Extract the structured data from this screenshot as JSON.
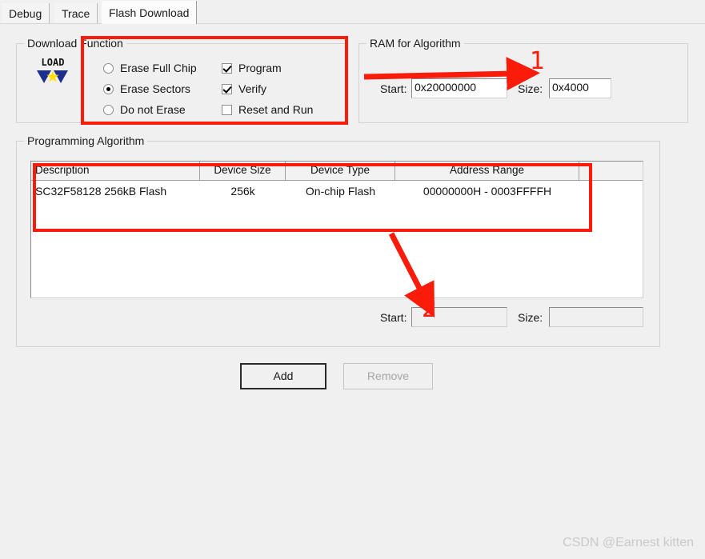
{
  "window": {
    "title": "Flash Download"
  },
  "tabs": [
    {
      "label": "Debug",
      "active": false
    },
    {
      "label": "Trace",
      "active": false
    },
    {
      "label": "Flash Download",
      "active": true
    }
  ],
  "download_function": {
    "legend": "Download Function",
    "icon_label": "LOAD",
    "erase_options": [
      {
        "label": "Erase Full Chip",
        "selected": false
      },
      {
        "label": "Erase Sectors",
        "selected": true
      },
      {
        "label": "Do not Erase",
        "selected": false
      }
    ],
    "checkboxes": [
      {
        "label": "Program",
        "checked": true
      },
      {
        "label": "Verify",
        "checked": true
      },
      {
        "label": "Reset and Run",
        "checked": false
      }
    ]
  },
  "ram_for_algorithm": {
    "legend": "RAM for Algorithm",
    "start_label": "Start:",
    "start_value": "0x20000000",
    "size_label": "Size:",
    "size_value": "0x4000"
  },
  "programming_algorithm": {
    "legend": "Programming Algorithm",
    "columns": [
      "Description",
      "Device Size",
      "Device Type",
      "Address Range",
      ""
    ],
    "rows": [
      {
        "description": "SC32F58128 256kB Flash",
        "device_size": "256k",
        "device_type": "On-chip Flash",
        "address_range": "00000000H - 0003FFFFH",
        "extra": ""
      }
    ],
    "start_label": "Start:",
    "start_value": "",
    "size_label": "Size:",
    "size_value": ""
  },
  "buttons": {
    "add": "Add",
    "remove": "Remove"
  },
  "annotations": {
    "marker_1": "1",
    "marker_2": "2",
    "color": "#f91c0b"
  },
  "watermark": "CSDN @Earnest kitten"
}
